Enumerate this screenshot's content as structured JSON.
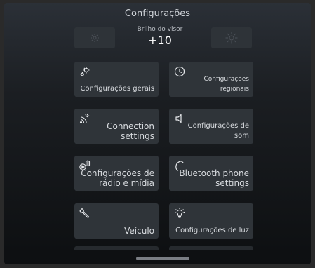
{
  "header": {
    "title": "Configurações"
  },
  "brightness": {
    "label": "Brilho do visor",
    "value": "+10",
    "decrease_icon": "sun-dim-icon",
    "increase_icon": "sun-bright-icon"
  },
  "tiles": [
    {
      "label": "Configurações gerais",
      "icon": "gears-icon"
    },
    {
      "label": "Configurações regionais",
      "icon": "clock-icon"
    },
    {
      "label_line1": "Connection",
      "label_line2": "settings",
      "icon": "connection-waves-icon"
    },
    {
      "label": "Configurações de som",
      "icon": "speaker-icon"
    },
    {
      "label_line1": "Configurações de",
      "label_line2": "rádio e mídia",
      "icon": "radio-media-icon"
    },
    {
      "label_line1": "Bluetooth phone",
      "label_line2": "settings",
      "icon": "bluetooth-phone-icon"
    },
    {
      "label": "Veículo",
      "icon": "wrench-icon"
    },
    {
      "label": "Configurações de luz",
      "icon": "lightbulb-icon"
    }
  ],
  "colors": {
    "tile_bg": "#2f3439",
    "text": "#d8dbdf",
    "background_top": "#2b3037",
    "background_bottom": "#0d0f11"
  }
}
